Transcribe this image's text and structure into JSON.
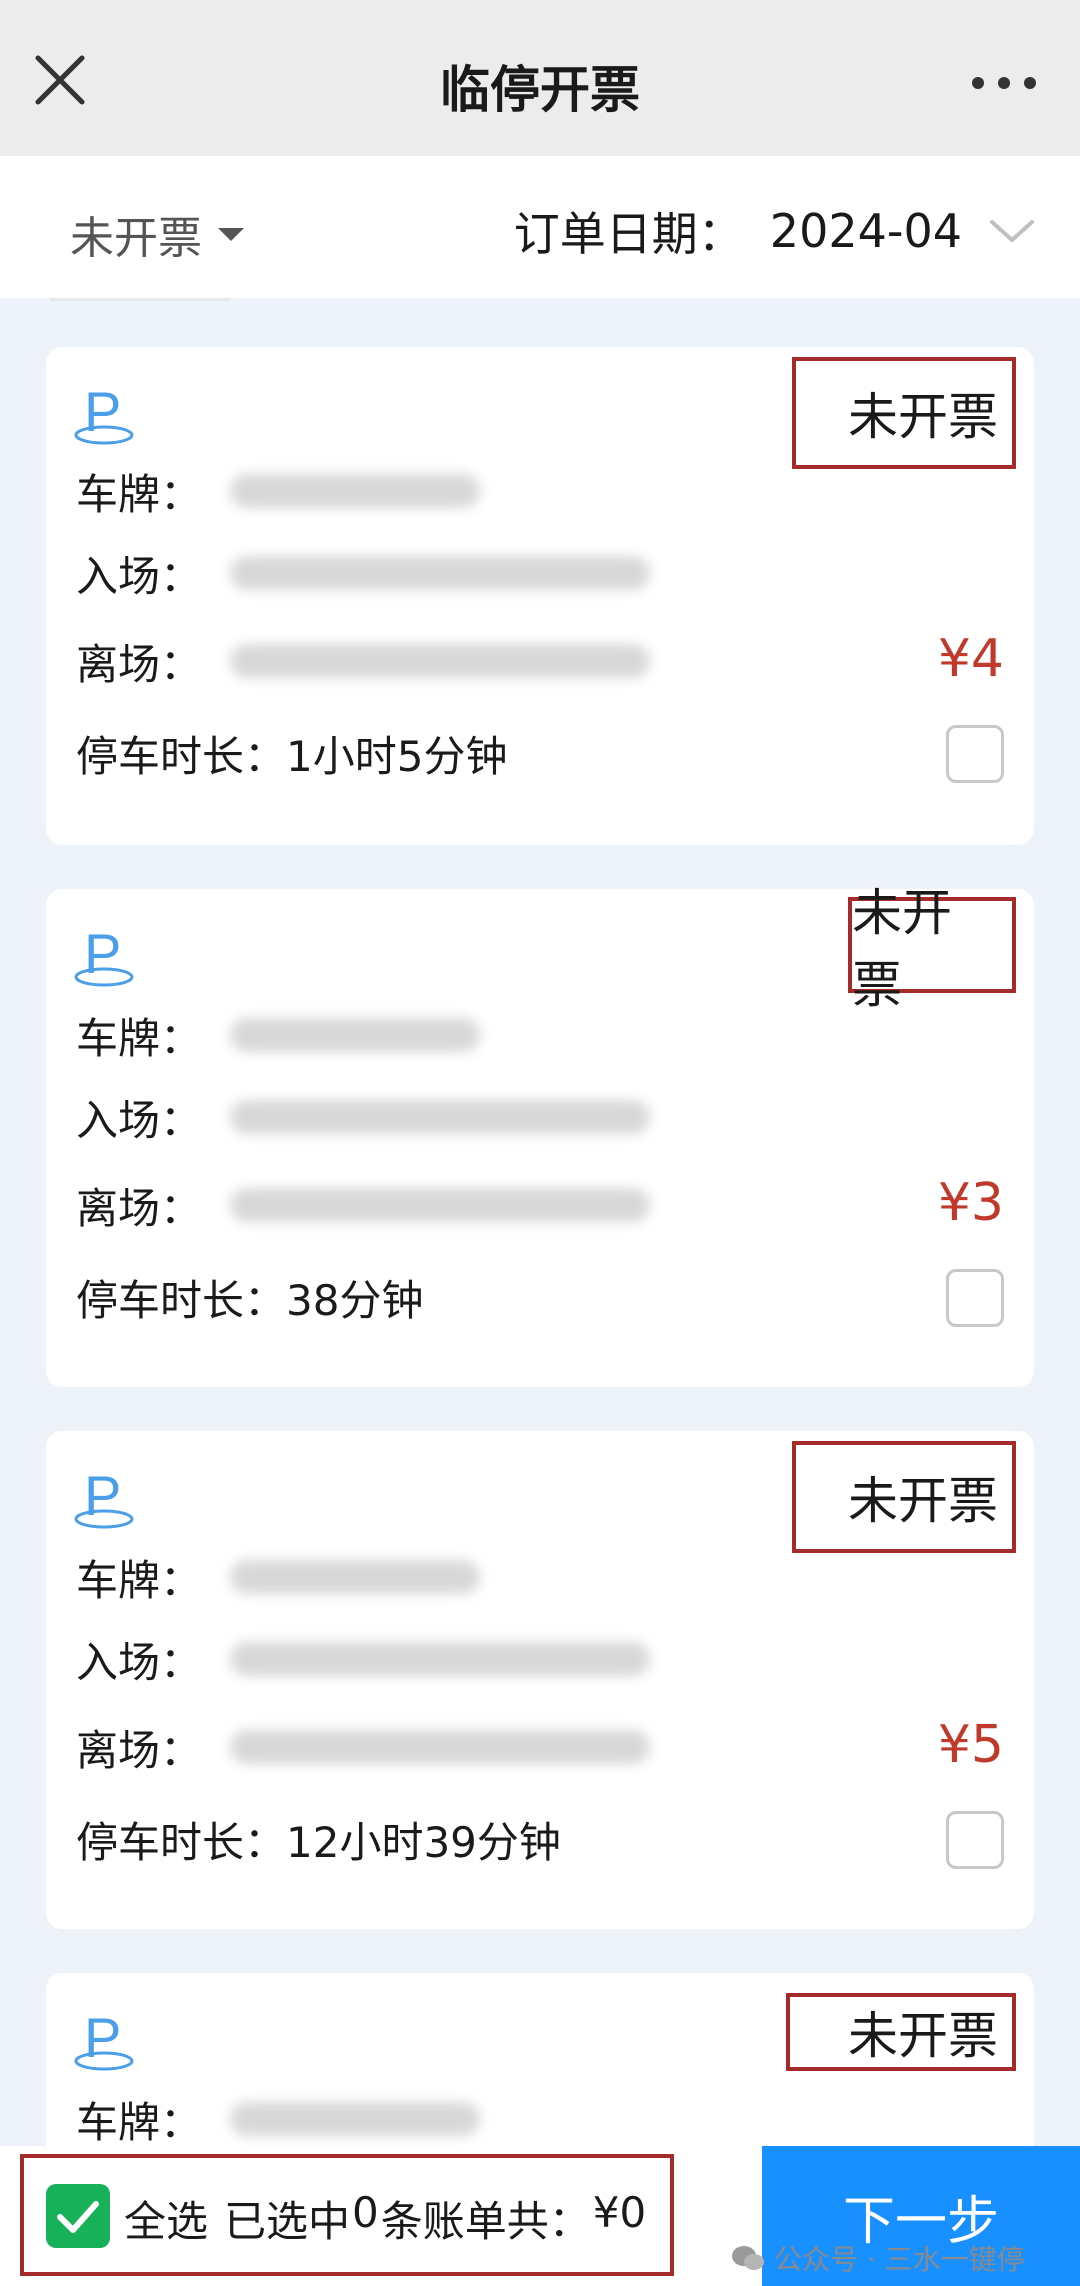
{
  "header": {
    "title": "临停开票"
  },
  "filter": {
    "status": "未开票",
    "date_label": "订单日期：",
    "date_value": "2024-04"
  },
  "labels": {
    "plate": "车牌：",
    "entry": "入场：",
    "exit": "离场：",
    "duration": "停车时长："
  },
  "orders": [
    {
      "status": "未开票",
      "amount": "¥4",
      "duration": "1小时5分钟",
      "selected": false
    },
    {
      "status": "未开票",
      "amount": "¥3",
      "duration": "38分钟",
      "selected": false
    },
    {
      "status": "未开票",
      "amount": "¥5",
      "duration": "12小时39分钟",
      "selected": false
    },
    {
      "status": "未开票"
    }
  ],
  "footer": {
    "select_all_label": "全选",
    "summary_prefix": "已选中",
    "selected_count": "0",
    "summary_mid": "条账单共：",
    "total": "¥0",
    "next_label": "下一步",
    "watermark": "公众号 · 三水一键停"
  },
  "colors": {
    "accent": "#1890ff",
    "amount": "#c0392b",
    "check": "#17b15a",
    "highlight_border": "#a52a2a"
  }
}
